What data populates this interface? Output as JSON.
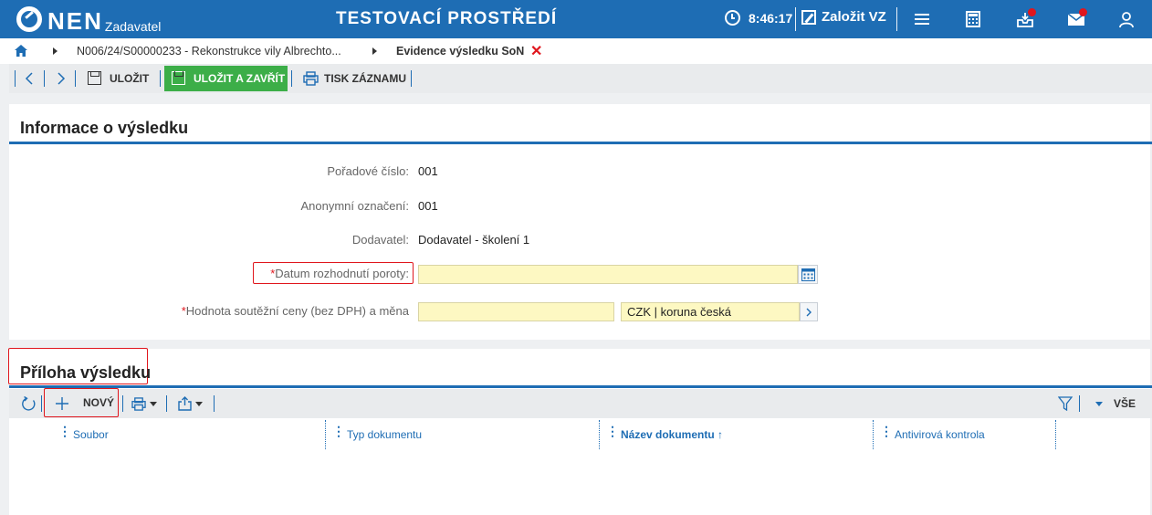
{
  "topbar": {
    "logo_text": "NEN",
    "logo_sub": "Zadavatel",
    "environment_title": "TESTOVACÍ PROSTŘEDÍ",
    "time": "8:46:17",
    "create_label": "Založit VZ",
    "icons": [
      "clock-icon",
      "menu-icon",
      "calculator-icon",
      "inbox-icon",
      "mail-icon",
      "user-icon"
    ],
    "badge_color": "#e0161d",
    "bar_color": "#1e6db4"
  },
  "breadcrumb": {
    "items": [
      {
        "label": "N006/24/S00000233 - Rekonstrukce vily Albrechto..."
      },
      {
        "label": "Evidence výsledku SoN"
      }
    ]
  },
  "toolbar": {
    "save_label": "ULOŽIT",
    "save_close_label": "ULOŽIT A ZAVŘÍT",
    "print_label": "TISK ZÁZNAMU",
    "accent_green": "#3cae48"
  },
  "info_section": {
    "title": "Informace o výsledku",
    "fields": {
      "poradove_cislo": {
        "label": "Pořadové číslo:",
        "value": "001"
      },
      "anonymni_oznaceni": {
        "label": "Anonymní označení:",
        "value": "001"
      },
      "dodavatel": {
        "label": "Dodavatel:",
        "value": "Dodavatel - školení 1"
      },
      "datum_rozhodnuti": {
        "label": "Datum rozhodnutí poroty:",
        "required": "*",
        "value": ""
      },
      "hodnota": {
        "label": "Hodnota soutěžní ceny (bez DPH) a měna",
        "required": "*",
        "value": "",
        "currency": "CZK | koruna česká"
      }
    }
  },
  "attachment_section": {
    "title": "Příloha výsledku",
    "new_label": "NOVÝ",
    "filter_all_label": "VŠE",
    "columns": [
      {
        "label": "Soubor"
      },
      {
        "label": "Typ dokumentu"
      },
      {
        "label": "Název dokumentu ↑"
      },
      {
        "label": "Antivirová kontrola"
      }
    ]
  }
}
